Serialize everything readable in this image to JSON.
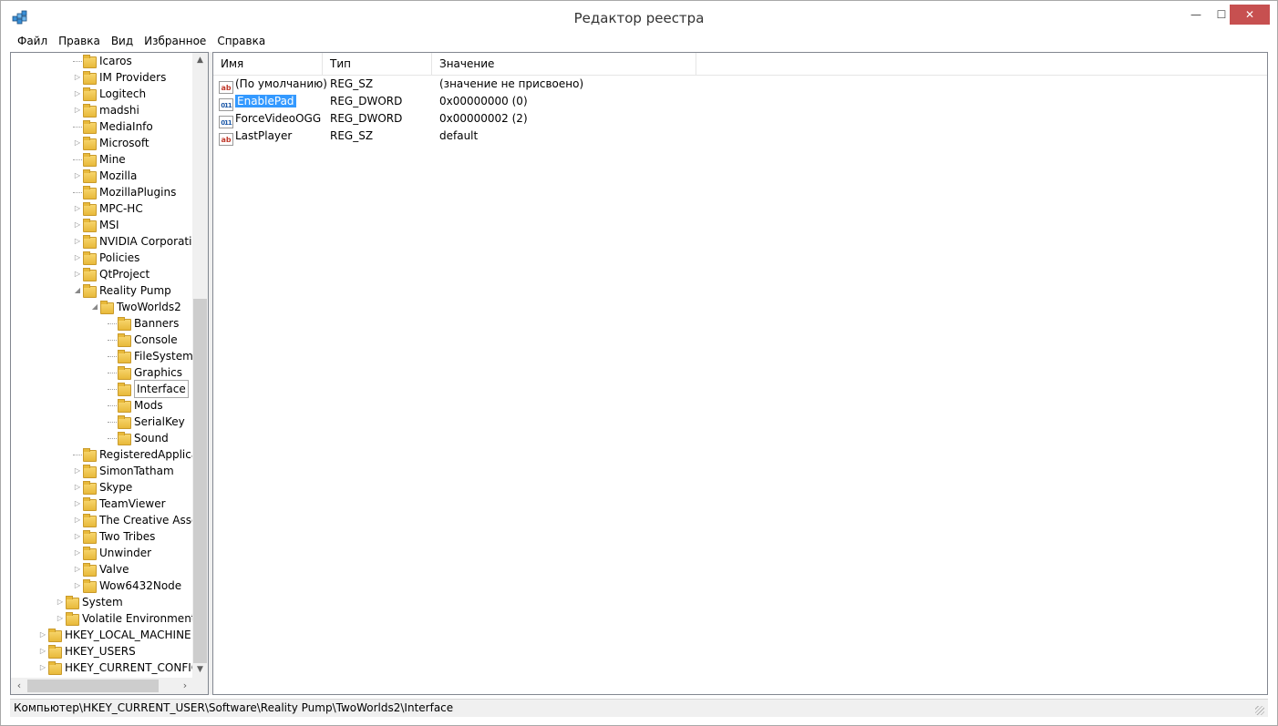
{
  "window": {
    "title": "Редактор реестра",
    "minimize_glyph": "—",
    "maximize_glyph": "☐",
    "close_glyph": "✕"
  },
  "menu": [
    "Файл",
    "Правка",
    "Вид",
    "Избранное",
    "Справка"
  ],
  "tree": {
    "items": [
      {
        "label": "Icaros",
        "level": 3,
        "expandable": false,
        "expanded": false
      },
      {
        "label": "IM Providers",
        "level": 3,
        "expandable": true,
        "expanded": false
      },
      {
        "label": "Logitech",
        "level": 3,
        "expandable": true,
        "expanded": false
      },
      {
        "label": "madshi",
        "level": 3,
        "expandable": true,
        "expanded": false
      },
      {
        "label": "MediaInfo",
        "level": 3,
        "expandable": false,
        "expanded": false
      },
      {
        "label": "Microsoft",
        "level": 3,
        "expandable": true,
        "expanded": false
      },
      {
        "label": "Mine",
        "level": 3,
        "expandable": false,
        "expanded": false
      },
      {
        "label": "Mozilla",
        "level": 3,
        "expandable": true,
        "expanded": false
      },
      {
        "label": "MozillaPlugins",
        "level": 3,
        "expandable": false,
        "expanded": false
      },
      {
        "label": "MPC-HC",
        "level": 3,
        "expandable": true,
        "expanded": false
      },
      {
        "label": "MSI",
        "level": 3,
        "expandable": true,
        "expanded": false
      },
      {
        "label": "NVIDIA Corporatic",
        "level": 3,
        "expandable": true,
        "expanded": false
      },
      {
        "label": "Policies",
        "level": 3,
        "expandable": true,
        "expanded": false
      },
      {
        "label": "QtProject",
        "level": 3,
        "expandable": true,
        "expanded": false
      },
      {
        "label": "Reality Pump",
        "level": 3,
        "expandable": true,
        "expanded": true
      },
      {
        "label": "TwoWorlds2",
        "level": 4,
        "expandable": true,
        "expanded": true
      },
      {
        "label": "Banners",
        "level": 5,
        "expandable": false,
        "expanded": false
      },
      {
        "label": "Console",
        "level": 5,
        "expandable": false,
        "expanded": false
      },
      {
        "label": "FileSystem",
        "level": 5,
        "expandable": false,
        "expanded": false
      },
      {
        "label": "Graphics",
        "level": 5,
        "expandable": false,
        "expanded": false
      },
      {
        "label": "Interface",
        "level": 5,
        "expandable": false,
        "expanded": false,
        "selected": true
      },
      {
        "label": "Mods",
        "level": 5,
        "expandable": false,
        "expanded": false
      },
      {
        "label": "SerialKey",
        "level": 5,
        "expandable": false,
        "expanded": false
      },
      {
        "label": "Sound",
        "level": 5,
        "expandable": false,
        "expanded": false
      },
      {
        "label": "RegisteredApplica",
        "level": 3,
        "expandable": false,
        "expanded": false
      },
      {
        "label": "SimonTatham",
        "level": 3,
        "expandable": true,
        "expanded": false
      },
      {
        "label": "Skype",
        "level": 3,
        "expandable": true,
        "expanded": false
      },
      {
        "label": "TeamViewer",
        "level": 3,
        "expandable": true,
        "expanded": false
      },
      {
        "label": "The Creative Asser",
        "level": 3,
        "expandable": true,
        "expanded": false
      },
      {
        "label": "Two Tribes",
        "level": 3,
        "expandable": true,
        "expanded": false
      },
      {
        "label": "Unwinder",
        "level": 3,
        "expandable": true,
        "expanded": false
      },
      {
        "label": "Valve",
        "level": 3,
        "expandable": true,
        "expanded": false
      },
      {
        "label": "Wow6432Node",
        "level": 3,
        "expandable": true,
        "expanded": false
      },
      {
        "label": "System",
        "level": 2,
        "expandable": true,
        "expanded": false
      },
      {
        "label": "Volatile Environment",
        "level": 2,
        "expandable": true,
        "expanded": false
      },
      {
        "label": "HKEY_LOCAL_MACHINE",
        "level": 1,
        "expandable": true,
        "expanded": false
      },
      {
        "label": "HKEY_USERS",
        "level": 1,
        "expandable": true,
        "expanded": false
      },
      {
        "label": "HKEY_CURRENT_CONFIG",
        "level": 1,
        "expandable": true,
        "expanded": false
      }
    ]
  },
  "values": {
    "columns": [
      "Имя",
      "Тип",
      "Значение"
    ],
    "rows": [
      {
        "icon": "string-value-icon",
        "name": "(По умолчанию)",
        "type": "REG_SZ",
        "data": "(значение не присвоено)",
        "selected": false
      },
      {
        "icon": "binary-value-icon",
        "name": "EnablePad",
        "type": "REG_DWORD",
        "data": "0x00000000 (0)",
        "selected": true
      },
      {
        "icon": "binary-value-icon",
        "name": "ForceVideoOGG",
        "type": "REG_DWORD",
        "data": "0x00000002 (2)",
        "selected": false
      },
      {
        "icon": "string-value-icon",
        "name": "LastPlayer",
        "type": "REG_SZ",
        "data": "default",
        "selected": false
      }
    ]
  },
  "status": {
    "path": "Компьютер\\HKEY_CURRENT_USER\\Software\\Reality Pump\\TwoWorlds2\\Interface"
  },
  "colors": {
    "selection": "#3399ff",
    "close_button": "#c75050",
    "folder": "#f7d56d"
  }
}
